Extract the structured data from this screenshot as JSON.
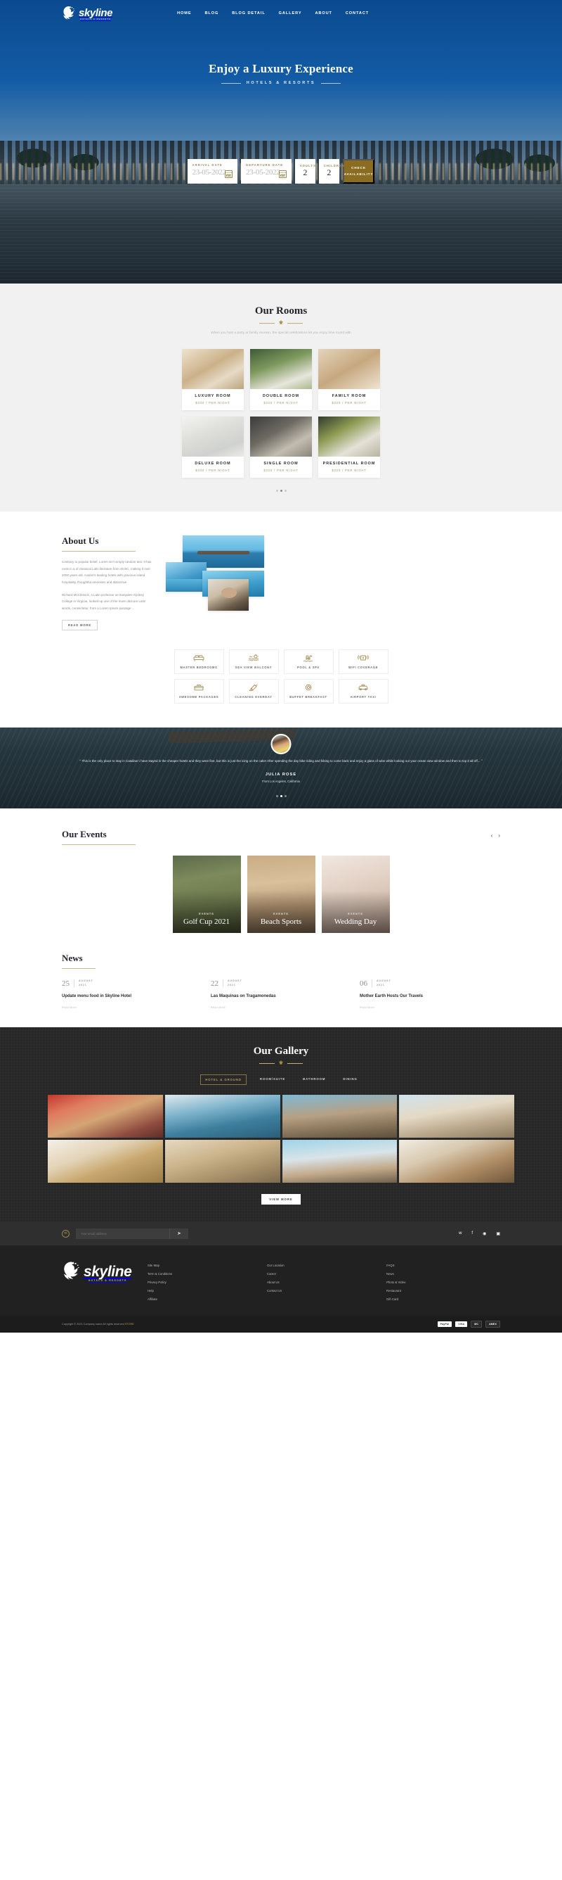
{
  "brand": {
    "word": "skyline",
    "sub": "HOTELS & RESORTS"
  },
  "nav": [
    {
      "label": "HOME"
    },
    {
      "label": "BLOG"
    },
    {
      "label": "BLOG DETAIL"
    },
    {
      "label": "GALLERY"
    },
    {
      "label": "ABOUT"
    },
    {
      "label": "CONTACT"
    }
  ],
  "hero": {
    "title": "Enjoy a Luxury Experience",
    "subtitle": "HOTELS & RESORTS"
  },
  "booking": {
    "arrival_label": "ARRIVAL DATE",
    "arrival_value": "23-05-2022",
    "departure_label": "DEPARTURE DATE",
    "departure_value": "23-05-2022",
    "adults_label": "ADULTS",
    "adults_value": "2",
    "children_label": "CHILDREN",
    "children_value": "2",
    "submit": "CHECK AVAILABILITY"
  },
  "rooms": {
    "title": "Our Rooms",
    "desc": "When you host a party or family reunion, the special celebrations let you enjoy time round with",
    "items": [
      {
        "name": "LUXURY ROOM",
        "price": "$320 / PER NIGHT"
      },
      {
        "name": "DOUBLE ROOM",
        "price": "$320 / PER NIGHT"
      },
      {
        "name": "FAMILY ROOM",
        "price": "$320 / PER NIGHT"
      },
      {
        "name": "DELUXE ROOM",
        "price": "$320 / PER NIGHT"
      },
      {
        "name": "SINGLE ROOM",
        "price": "$320 / PER NIGHT"
      },
      {
        "name": "PRESIDENTIAL ROOM",
        "price": "$320 / PER NIGHT"
      }
    ]
  },
  "about": {
    "title": "About Us",
    "p1": "Contrary to popular belief, Lorem isn't simply random text. It has roots in a of classical Latin literature from 45 BC, making it over 2000 years old. Avalon's leading hotels with gracious island hospitality, thoughtful amenities and distinctive",
    "p2": "Richard McClintock, a Latin professor at Hampden-Sydney College in Virginia, looked up one of the more obscure Latin words, consectetur, from a Lorem Ipsum passage ...",
    "read_more": "READ MORE"
  },
  "amenities": [
    {
      "label": "MASTER BEDROOMS",
      "icon": "bed-icon"
    },
    {
      "label": "SEA VIEW BALCONY",
      "icon": "sea-view-icon"
    },
    {
      "label": "POOL & SPA",
      "icon": "pool-spa-icon"
    },
    {
      "label": "WIFI COVERAGE",
      "icon": "wifi-icon"
    },
    {
      "label": "AWESOME PACKAGES",
      "icon": "package-icon"
    },
    {
      "label": "CLEANING EVERDAY",
      "icon": "cleaning-icon"
    },
    {
      "label": "BUFFET BREAKFAST",
      "icon": "breakfast-icon"
    },
    {
      "label": "AIRPORT TAXI",
      "icon": "taxi-icon"
    }
  ],
  "testimonial": {
    "quote": "This is the only place to stay in Catalina! i have stayed in the cheaper hotels and they were fine, but this is just the icing on the cake! After spending the day bike riding and hiking to come back and enjoy a glass of wine while looking out your ocean view window and then to top it all off...",
    "name": "JULIA ROSE",
    "from": "From Los Angeles, California"
  },
  "events": {
    "title": "Our Events",
    "prev": "‹",
    "next": "›",
    "items": [
      {
        "tag": "EVENTS",
        "title": "Golf Cup 2021"
      },
      {
        "tag": "EVENTS",
        "title": "Beach Sports"
      },
      {
        "tag": "EVENTS",
        "title": "Wedding Day"
      }
    ]
  },
  "news": {
    "title": "News",
    "items": [
      {
        "day": "25",
        "month": "AUGUST",
        "year": "2021",
        "headline": "Update menu food in Skyline Hotel",
        "more": "Read More"
      },
      {
        "day": "22",
        "month": "AUGUST",
        "year": "2021",
        "headline": "Las Maquinas on Tragamonedas",
        "more": "Read More"
      },
      {
        "day": "06",
        "month": "AUGUST",
        "year": "2021",
        "headline": "Mother Earth Hosts Our Travels",
        "more": "Read More"
      }
    ]
  },
  "gallery": {
    "title": "Our Gallery",
    "tabs": [
      {
        "label": "HOTEL & GROUND",
        "active": true
      },
      {
        "label": "ROOM/SUITE",
        "active": false
      },
      {
        "label": "BATHROOM",
        "active": false
      },
      {
        "label": "DINING",
        "active": false
      }
    ],
    "view_more": "VIEW MORE"
  },
  "newsletter": {
    "placeholder": "Your email address",
    "value": "",
    "socials": [
      "twitter-icon",
      "facebook-icon",
      "flickr-icon",
      "instagram-icon"
    ]
  },
  "footer": {
    "col1": [
      {
        "label": "Site Map"
      },
      {
        "label": "Term & Conditions"
      },
      {
        "label": "Privacy Policy"
      },
      {
        "label": "Help"
      },
      {
        "label": "Affiliate"
      }
    ],
    "col2": [
      {
        "label": "Our Location"
      },
      {
        "label": "Career"
      },
      {
        "label": "About Us"
      },
      {
        "label": "Contact Us"
      }
    ],
    "col3": [
      {
        "label": "FAQS"
      },
      {
        "label": "News"
      },
      {
        "label": "Photo & Video"
      },
      {
        "label": "Restaurant"
      },
      {
        "label": "Gift Card"
      }
    ],
    "copyright_pre": "Copyright © 2021 Company name All rights reserved ",
    "copyright_link": "STORE",
    "payments": [
      "PayPal",
      "VISA",
      "MC",
      "AMEX"
    ]
  },
  "colors": {
    "gold": "#8a6d20",
    "dark": "#212121",
    "hero_blue": "#0b4a8f"
  }
}
